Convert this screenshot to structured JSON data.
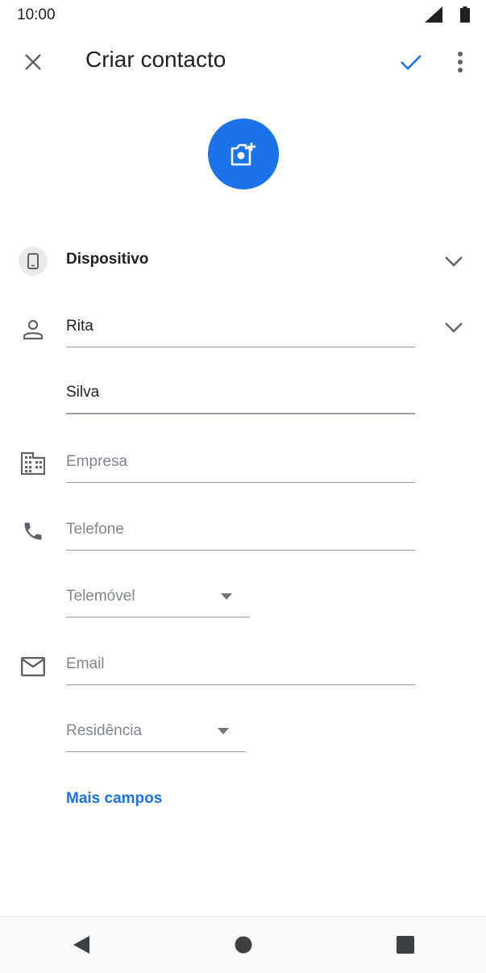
{
  "status": {
    "time": "10:00"
  },
  "header": {
    "title": "Criar contacto"
  },
  "account": {
    "label": "Dispositivo"
  },
  "name": {
    "first": "Rita",
    "last": "Silva"
  },
  "company": {
    "placeholder": "Empresa"
  },
  "phone": {
    "placeholder": "Telefone",
    "type": "Telemóvel"
  },
  "email": {
    "placeholder": "Email",
    "type": "Residência"
  },
  "more_fields": "Mais campos",
  "colors": {
    "accent": "#1a73e8",
    "icon": "#5f6368",
    "hint": "#80868b"
  }
}
